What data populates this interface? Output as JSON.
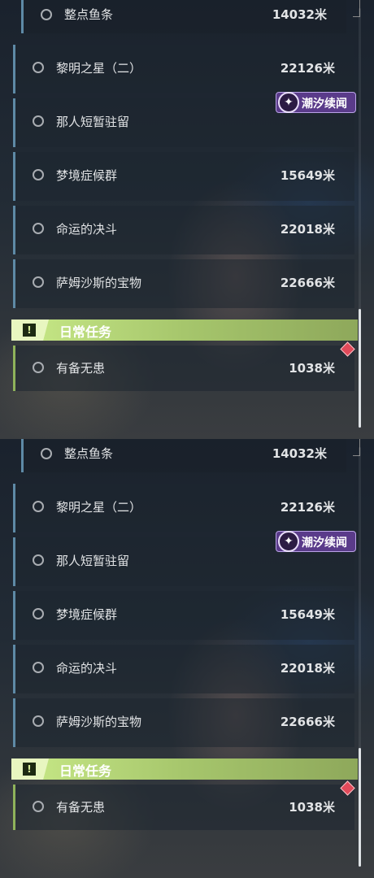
{
  "quests": [
    {
      "name": "整点鱼条",
      "distance": "14032米"
    },
    {
      "name": "黎明之星（二）",
      "distance": "22126米"
    },
    {
      "name": "那人短暂驻留",
      "distance": ""
    },
    {
      "name": "梦境症候群",
      "distance": "15649米"
    },
    {
      "name": "命运的决斗",
      "distance": "22018米"
    },
    {
      "name": "萨姆沙斯的宝物",
      "distance": "22666米"
    }
  ],
  "event_badge": {
    "label": "潮汐续闻"
  },
  "daily_section": {
    "title": "日常任务",
    "icon_glyph": "!",
    "items": [
      {
        "name": "有备无患",
        "distance": "1038米"
      }
    ]
  },
  "colors": {
    "quest_bar": "#5e8aa6",
    "daily_bar": "#8fb35b",
    "section_green": "#c9ea88",
    "badge_purple": "#5a3b8a",
    "marker_red": "#e14a5a"
  }
}
